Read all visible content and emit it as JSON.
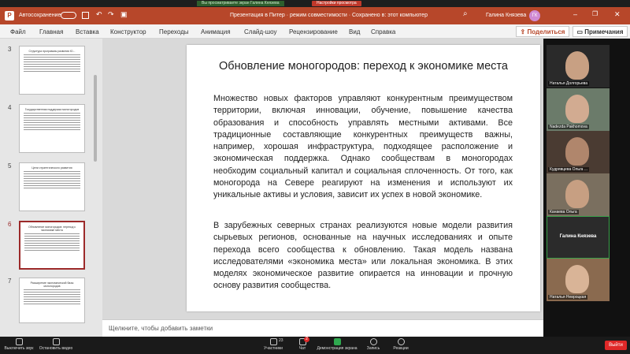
{
  "zoom_top": {
    "notice": "Вы просматриваете экран Галина Князева",
    "settings_label": "Настройки просмотра"
  },
  "titlebar": {
    "autosave_label": "Автосохранение",
    "autosave_state": "Откл",
    "doc_title": "Презентация в Питер  ·  режим совместимости  ·  Сохранено в: этот компьютер",
    "user_name": "Галина Князева",
    "user_initials": "ГК"
  },
  "ribbon": {
    "menu": [
      "Файл",
      "Главная",
      "Вставка",
      "Конструктор",
      "Переходы",
      "Анимация",
      "Слайд-шоу",
      "Рецензирование",
      "Вид",
      "Справка"
    ],
    "share": "Поделиться",
    "comments": "Примечания"
  },
  "thumbnails": [
    {
      "num": "3",
      "title": "Структура программы развития Ю...",
      "active": false
    },
    {
      "num": "4",
      "title": "Государственная поддержка моногородов",
      "active": false
    },
    {
      "num": "5",
      "title": "Цели стратегического развития",
      "active": false
    },
    {
      "num": "6",
      "title": "Обновление моногородов: переход к экономике места",
      "active": true
    },
    {
      "num": "7",
      "title": "Расширение экономической базы моногородов",
      "active": false
    }
  ],
  "slide": {
    "title": "Обновление моногородов: переход  к экономике места",
    "para1": "Множество новых факторов управляют конкурентным преимуществом территории, включая инновации, обучение, повышение качества образования и способность управлять местными активами. Все традиционные составляющие конкурентных преимуществ важны, например, хорошая инфраструктура, подходящее расположение и экономическая поддержка. Однако сообществам в моногородах необходим социальный капитал и социальная сплоченность. От того, как моногорода на Севере реагируют на изменения и используют их уникальные активы и условия, зависит их успех в новой экономике.",
    "para2": "В зарубежных северных странах реализуются новые модели развития сырьевых регионов, основанные на научных исследованиях и опыте перехода всего сообщества к обновлению. Такая модель названа исследователями «экономика  места» или локальная экономика. В этих моделях экономическое развитие опирается на инновации и  прочную основу развития сообщества."
  },
  "notes_placeholder": "Щелкните, чтобы добавить заметки",
  "participants": [
    {
      "name": "Наталья Долгорьева"
    },
    {
      "name": "Nadezda Pakhomova"
    },
    {
      "name": "Кудрявцева Ольга ..."
    },
    {
      "name": "Канаева Ольга"
    },
    {
      "name": "Галина Князева"
    },
    {
      "name": "Наталья Невроцкая"
    }
  ],
  "zoom_bottom": {
    "mute": "Выключить звук",
    "video": "Остановить видео",
    "participants": "Участники",
    "participants_count": "23",
    "chat": "Чат",
    "chat_badge": "2",
    "share": "Демонстрация экрана",
    "record": "Запись",
    "reactions": "Реакции",
    "leave": "Выйти"
  },
  "colors": {
    "ppt_accent": "#b7472a",
    "zoom_share": "#2fa84f",
    "leave": "#e02828"
  }
}
